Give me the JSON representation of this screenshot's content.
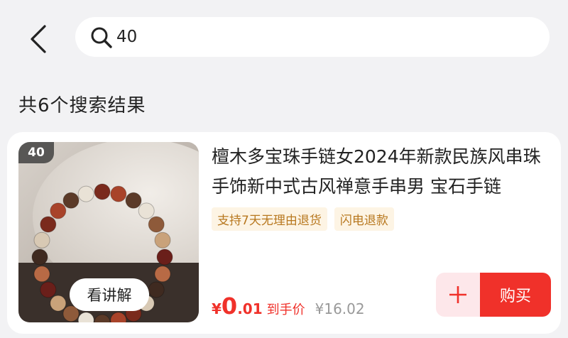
{
  "header": {
    "back_icon": "chevron-left-icon",
    "search": {
      "icon": "search-icon",
      "value": "40",
      "placeholder": ""
    }
  },
  "results": {
    "count_label": "共6个搜索结果"
  },
  "product": {
    "rank_badge": "40",
    "explain_label": "看讲解",
    "title": "檀木多宝珠手链女2024年新款民族风串珠手饰新中式古风禅意手串男 宝石手链",
    "tags": [
      "支持7天无理由退货",
      "闪电退款"
    ],
    "price": {
      "currency": "¥",
      "integer": "0",
      "decimal": ".01",
      "suffix": "到手价",
      "original": "¥16.02"
    },
    "add_icon": "plus-icon",
    "buy_label": "购买"
  },
  "colors": {
    "accent_red": "#f0312a",
    "tag_text": "#b8781f",
    "tag_bg": "#fdf4e4",
    "page_bg": "#f2f2f4"
  }
}
